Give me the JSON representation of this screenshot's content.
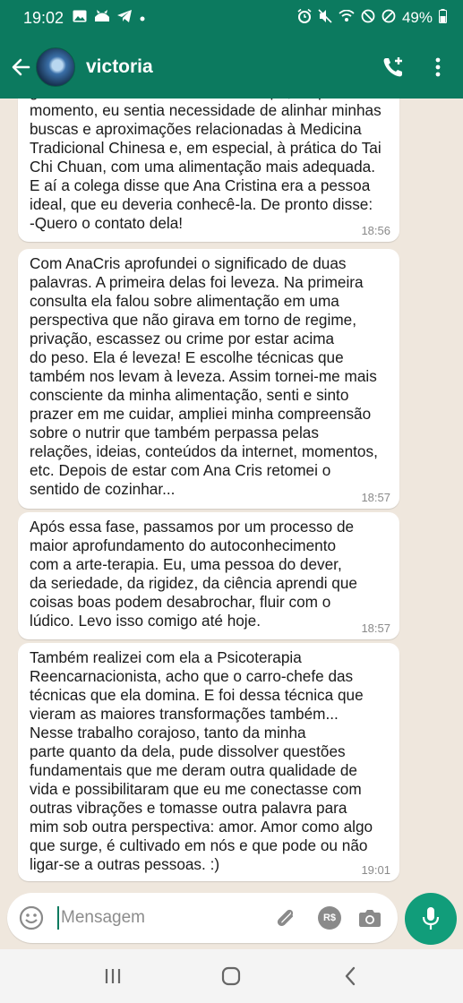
{
  "status_bar": {
    "time": "19:02",
    "battery": "49%",
    "left_icons": [
      "image-icon",
      "cat-icon",
      "telegram-icon",
      "dot-icon"
    ],
    "right_icons": [
      "alarm-icon",
      "mute-icon",
      "wifi-icon",
      "no-disturb-icon",
      "blocked-icon",
      "battery-icon"
    ]
  },
  "header": {
    "contact_name": "victoria",
    "icons": [
      "back-arrow-icon",
      "add-call-icon",
      "more-vert-icon"
    ],
    "accent_color": "#0c7a5f"
  },
  "messages": [
    {
      "text": "gesto de dieta. Mas ao mesmo tempo, naquele\nmomento, eu sentia necessidade de alinhar minhas\nbuscas e aproximações  relacionadas à Medicina\nTradicional Chinesa e, em especial, à prática do Tai\nChi Chuan, com uma alimentação mais adequada.\nE aí a colega disse que Ana Cristina era a pessoa\nideal, que eu deveria conhecê-la. De pronto disse:\n-Quero o contato dela!",
      "time": "18:56"
    },
    {
      "text": "Com AnaCris aprofundei o significado de duas\npalavras. A primeira delas foi leveza. Na primeira\nconsulta ela falou sobre alimentação em uma\nperspectiva que não girava em torno de regime,\nprivação, escassez ou crime por estar acima\ndo peso. Ela é leveza! E escolhe técnicas que\ntambém nos levam à leveza. Assim tornei-me mais\nconsciente da minha alimentação, senti e sinto\nprazer em me cuidar, ampliei minha compreensão\nsobre o nutrir que também perpassa pelas\nrelações, ideias, conteúdos da internet, momentos,\netc. Depois de estar com Ana Cris retomei o\nsentido de cozinhar...",
      "time": "18:57"
    },
    {
      "text": "Após essa fase, passamos por um processo de\nmaior aprofundamento do autoconhecimento\ncom a arte-terapia. Eu, uma pessoa do dever,\nda seriedade, da rigidez, da ciência aprendi que\ncoisas boas podem desabrochar, fluir com o\nlúdico. Levo isso comigo até hoje.",
      "time": "18:57"
    },
    {
      "text": "Também realizei com ela a Psicoterapia\nReencarnacionista, acho que o carro-chefe das\ntécnicas que ela domina. E foi dessa técnica que\nvieram as maiores transformações também...\nNesse trabalho corajoso, tanto da minha\nparte quanto da dela, pude dissolver questões\nfundamentais que me deram outra qualidade de\nvida e possibilitaram que eu me conectasse com\noutras vibrações e tomasse outra palavra para\nmim sob outra perspectiva: amor. Amor como algo\nque surge, é cultivado em nós e que pode ou não\nligar-se a outras pessoas. :)",
      "time": "19:01"
    }
  ],
  "input": {
    "placeholder": "Mensagem",
    "pay_label": "R$",
    "icons": [
      "emoji-icon",
      "paperclip-icon",
      "payment-icon",
      "camera-icon",
      "mic-icon"
    ]
  },
  "nav": {
    "icons": [
      "recent-apps-icon",
      "home-icon",
      "back-icon"
    ]
  }
}
